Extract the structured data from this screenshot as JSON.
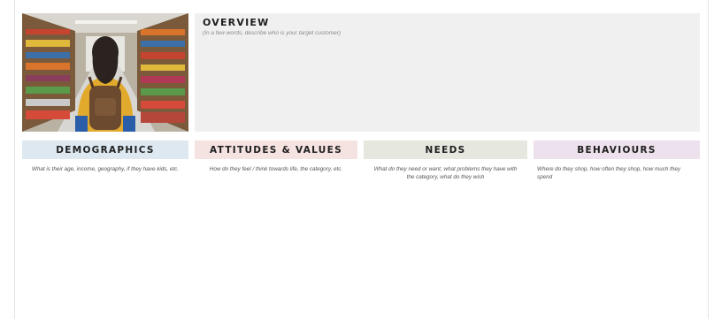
{
  "overview": {
    "title": "OVERVIEW",
    "subtitle": "(In a few words, describe who is your target customer)"
  },
  "columns": [
    {
      "title": "DEMOGRAPHICS",
      "description": "What is their age, income, geography, if they have kids, etc.",
      "color": "#dde8f0"
    },
    {
      "title": "ATTITUDES & VALUES",
      "description": "How do they feel / think towards life, the category, etc.",
      "color": "#f5e3e1"
    },
    {
      "title": "NEEDS",
      "description": "What do they need or want, what problems they have with the category, what do they wish",
      "color": "#e6e8e0"
    },
    {
      "title": "BEHAVIOURS",
      "description": "Where do they shop, how often they shop, how much they spend",
      "color": "#ece1ec"
    }
  ]
}
